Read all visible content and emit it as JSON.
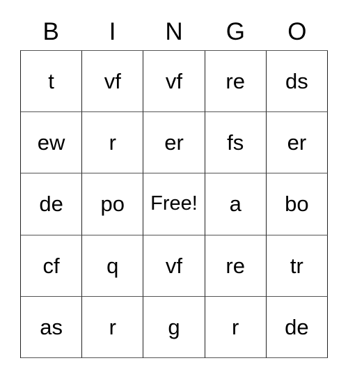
{
  "card": {
    "headers": [
      "B",
      "I",
      "N",
      "G",
      "O"
    ],
    "free_space_label": "Free!",
    "free_space_position": {
      "row": 2,
      "col": 2
    },
    "colors": {
      "background": "#ffffff",
      "text": "#000000",
      "grid_line": "#555555",
      "grid_border": "#222222"
    },
    "rows": [
      [
        "t",
        "vf",
        "vf",
        "re",
        "ds"
      ],
      [
        "ew",
        "r",
        "er",
        "fs",
        "er"
      ],
      [
        "de",
        "po",
        "Free!",
        "a",
        "bo"
      ],
      [
        "cf",
        "q",
        "vf",
        "re",
        "tr"
      ],
      [
        "as",
        "r",
        "g",
        "r",
        "de"
      ]
    ]
  }
}
